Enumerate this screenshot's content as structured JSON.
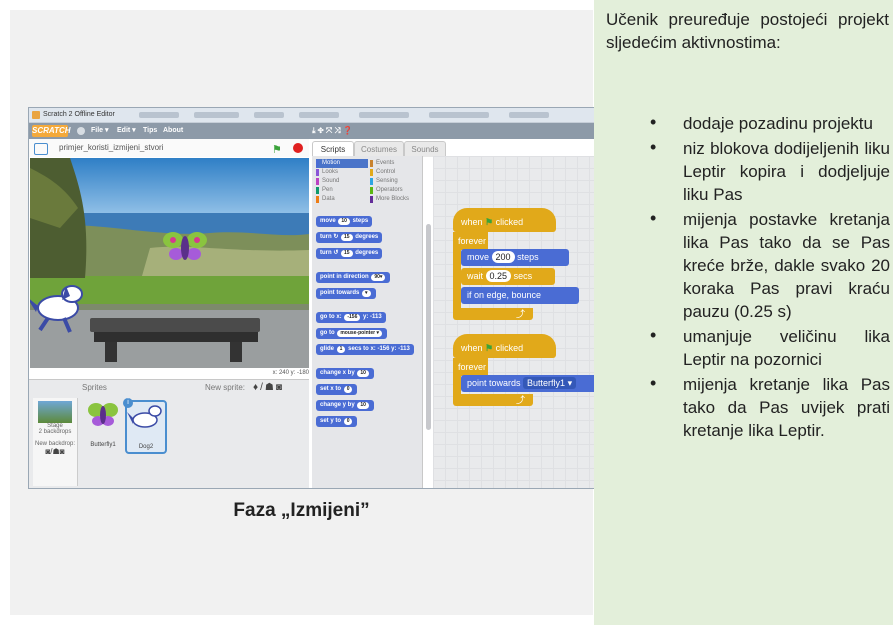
{
  "intro_text": "Učenik preuređuje postojeći projekt sljedećim aktivnostima:",
  "activities": [
    "dodaje pozadinu projektu",
    "niz blokova dodijeljenih liku Leptir kopira i dodjeljuje liku Pas",
    "mijenja postavke kretanja lika Pas tako da se Pas kreće brže, dakle svako 20 koraka Pas pravi kraću pauzu (0.25 s)",
    "umanjuje veličinu lika Leptir na pozornici",
    "mijenja kretanje lika Pas tako da Pas uvijek prati kretanje lika Leptir."
  ],
  "caption": "Faza „Izmijeni”",
  "scratch": {
    "window_title": "Scratch 2 Offline Editor",
    "logo": "SCRATCH",
    "menu": [
      "File ▾",
      "Edit ▾",
      "Tips",
      "About"
    ],
    "project_name": "primjer_koristi_izmijeni_stvori",
    "tabs": [
      "Scripts",
      "Costumes",
      "Sounds"
    ],
    "categories": [
      {
        "label": "Motion",
        "color": "#4a6cd4"
      },
      {
        "label": "Events",
        "color": "#c88330"
      },
      {
        "label": "Looks",
        "color": "#8a55d7"
      },
      {
        "label": "Control",
        "color": "#e1a91a"
      },
      {
        "label": "Sound",
        "color": "#bb42c3"
      },
      {
        "label": "Sensing",
        "color": "#2ca5e2"
      },
      {
        "label": "Pen",
        "color": "#0e9a6c"
      },
      {
        "label": "Operators",
        "color": "#5cb712"
      },
      {
        "label": "Data",
        "color": "#ee7d16"
      },
      {
        "label": "More Blocks",
        "color": "#632d99"
      }
    ],
    "palette_blocks": [
      {
        "pre": "move",
        "val": "10",
        "post": "steps"
      },
      {
        "pre": "turn ↻",
        "val": "15",
        "post": "degrees"
      },
      {
        "pre": "turn ↺",
        "val": "15",
        "post": "degrees"
      },
      {
        "pre": "point in direction",
        "val": "90▾",
        "post": ""
      },
      {
        "pre": "point towards",
        "val": "▾",
        "post": ""
      },
      {
        "pre": "go to x:",
        "val": "-156",
        "post": "y: -113"
      },
      {
        "pre": "go to",
        "val": "mouse-pointer ▾",
        "post": ""
      },
      {
        "pre": "glide",
        "val": "1",
        "post": "secs to x: -156 y: -113"
      },
      {
        "pre": "change x by",
        "val": "10",
        "post": ""
      },
      {
        "pre": "set x to",
        "val": "0",
        "post": ""
      },
      {
        "pre": "change y by",
        "val": "10",
        "post": ""
      },
      {
        "pre": "set y to",
        "val": "0",
        "post": ""
      }
    ],
    "script1": {
      "hat": "when",
      "hat_tail": "clicked",
      "loop": "forever",
      "move_pre": "move",
      "move_val": "200",
      "move_post": "steps",
      "wait_pre": "wait",
      "wait_val": "0.25",
      "wait_post": "secs",
      "bounce": "if on edge, bounce"
    },
    "script2": {
      "hat": "when",
      "hat_tail": "clicked",
      "loop": "forever",
      "point_pre": "point towards",
      "point_target": "Butterfly1 ▾"
    },
    "coords": "x: 240  y: -180",
    "sprites_label": "Sprites",
    "new_sprite_label": "New sprite:",
    "stage_label": "Stage",
    "stage_backdrops": "2 backdrops",
    "new_backdrop_label": "New backdrop:",
    "sprite_items": [
      "Butterfly1",
      "Dog2"
    ],
    "selected_badge": "i"
  }
}
